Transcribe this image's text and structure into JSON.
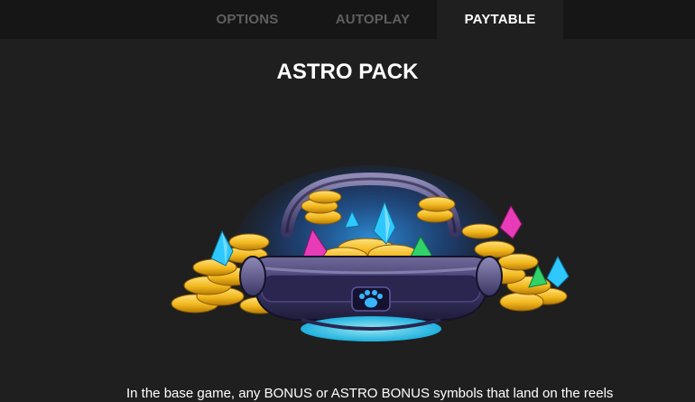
{
  "tabs": [
    {
      "label": "OPTIONS",
      "active": false
    },
    {
      "label": "AUTOPLAY",
      "active": false
    },
    {
      "label": "PAYTABLE",
      "active": true
    }
  ],
  "page": {
    "title": "ASTRO PACK",
    "description": "In the base game, any BONUS or ASTRO BONUS symbols that land on the reels"
  },
  "illustration": {
    "icon": "astro-pack-icon",
    "emblem": "paw-icon"
  },
  "colors": {
    "background": "#1f1f1f",
    "topbar": "#161616",
    "tab_inactive_text": "#5f5f5f",
    "tab_active_text": "#ffffff",
    "coin": "#f2b81d",
    "glow": "#2fa8ff",
    "crystal_blue": "#2ec8ff",
    "crystal_pink": "#e83bb8",
    "crystal_green": "#2fd36a"
  }
}
